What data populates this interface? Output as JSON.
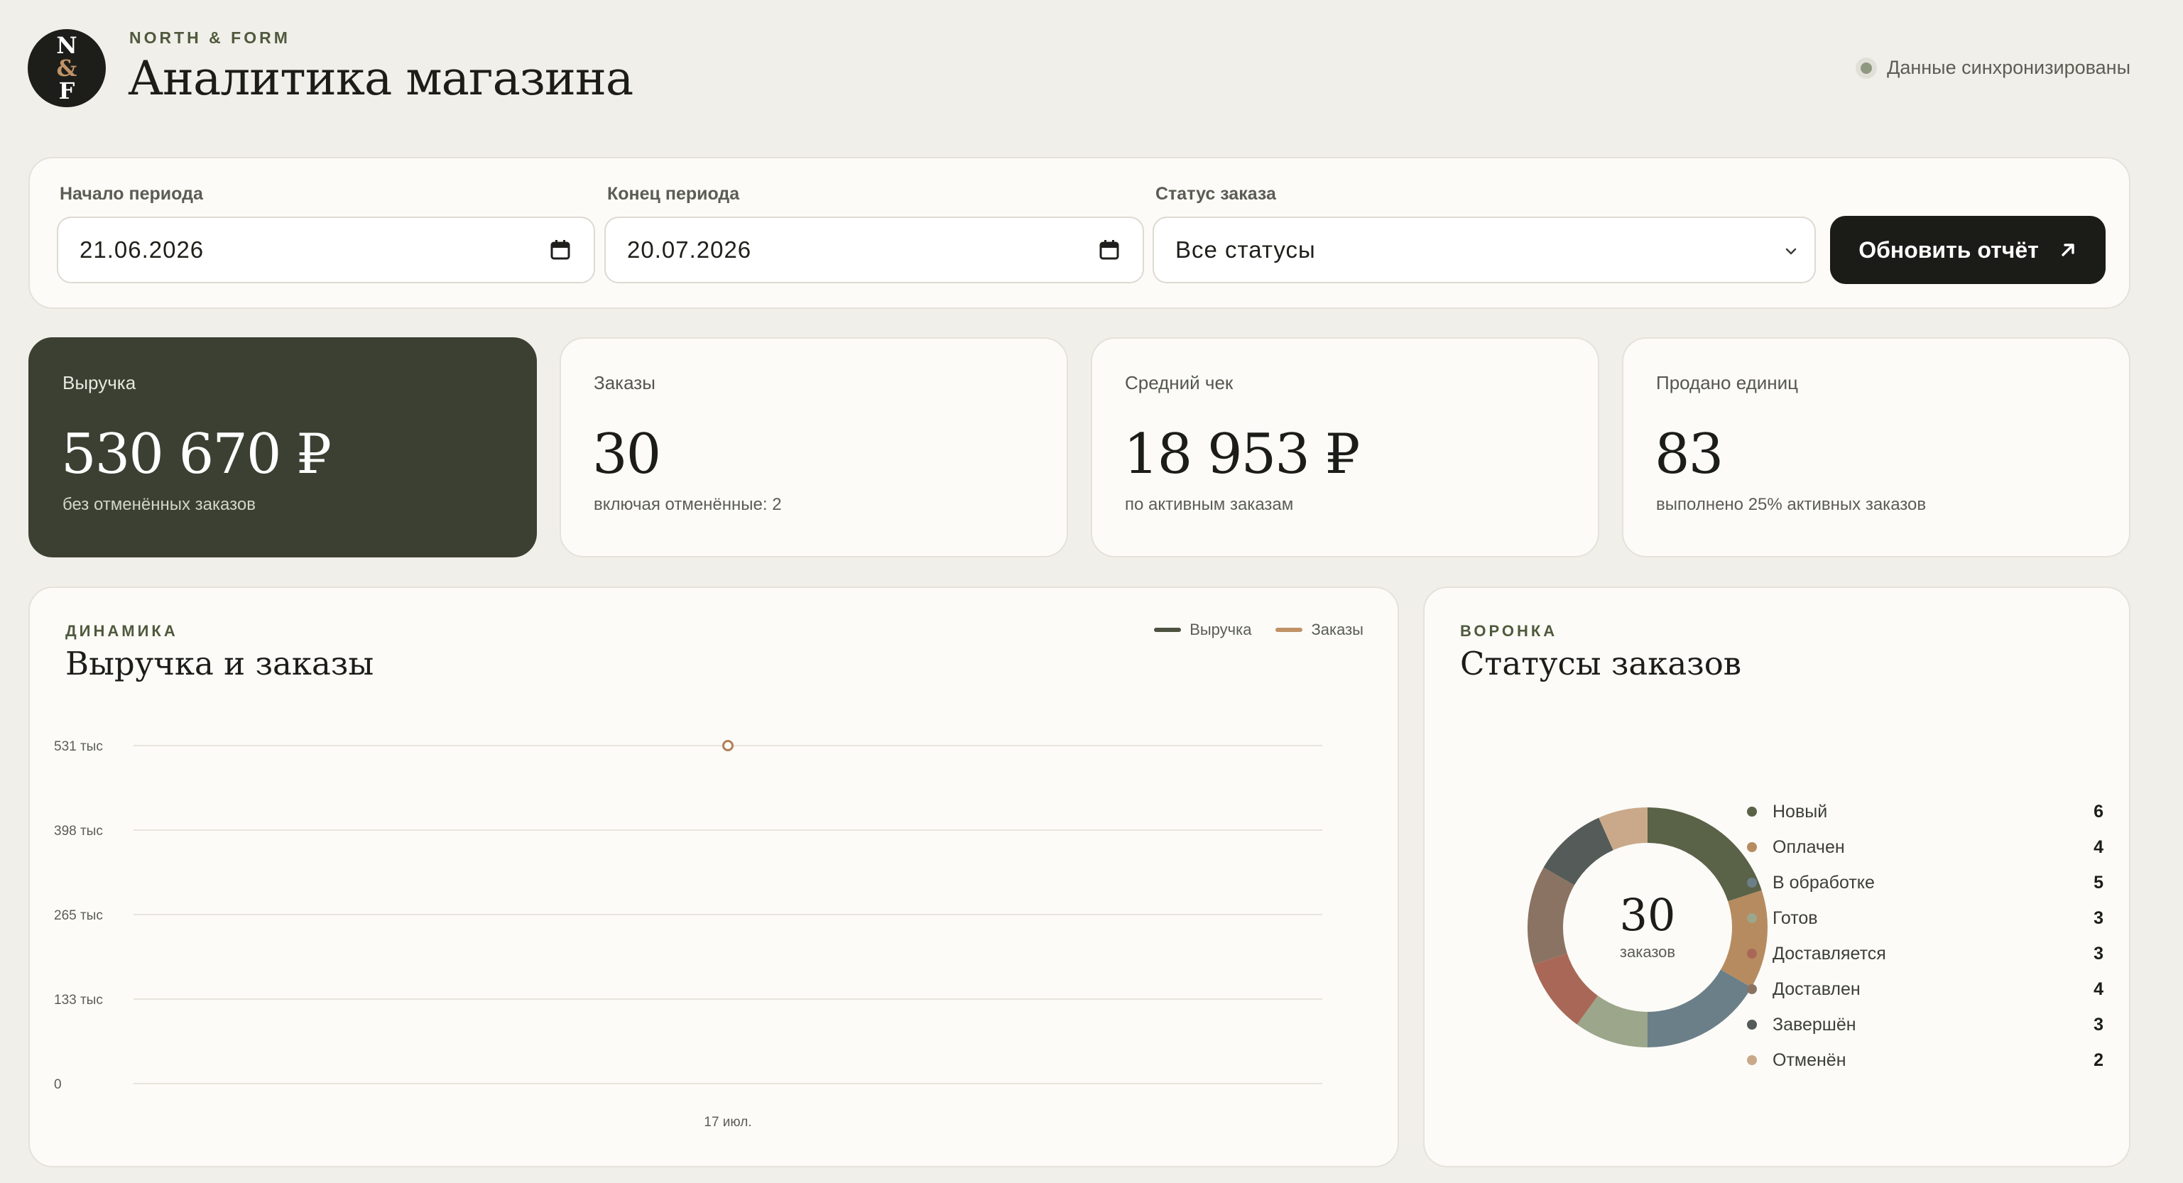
{
  "header": {
    "logo_letters": [
      "N",
      "&",
      "F"
    ],
    "brand": "NORTH & FORM",
    "title": "Аналитика магазина",
    "sync_status": "Данные синхронизированы"
  },
  "filters": {
    "start": {
      "label": "Начало периода",
      "value": "21.06.2026"
    },
    "end": {
      "label": "Конец периода",
      "value": "20.07.2026"
    },
    "status": {
      "label": "Статус заказа",
      "value": "Все статусы"
    },
    "refresh_label": "Обновить отчёт"
  },
  "kpis": [
    {
      "label": "Выручка",
      "value": "530 670 ₽",
      "note": "без отменённых заказов"
    },
    {
      "label": "Заказы",
      "value": "30",
      "note": "включая отменённые: 2"
    },
    {
      "label": "Средний чек",
      "value": "18 953 ₽",
      "note": "по активным заказам"
    },
    {
      "label": "Продано единиц",
      "value": "83",
      "note": "выполнено 25% активных заказов"
    }
  ],
  "dynamics": {
    "eyebrow": "ДИНАМИКА",
    "title": "Выручка и заказы",
    "legend": [
      {
        "name": "Выручка",
        "color": "#4c5240"
      },
      {
        "name": "Заказы",
        "color": "#c09267"
      }
    ]
  },
  "chart_data": {
    "type": "line",
    "x": [
      "17 июл."
    ],
    "series": [
      {
        "name": "Выручка",
        "values": [
          530670
        ]
      },
      {
        "name": "Заказы",
        "values": [
          30
        ]
      }
    ],
    "y_ticks": [
      "531 тыс",
      "398 тыс",
      "265 тыс",
      "133 тыс",
      "0"
    ],
    "ylim": [
      0,
      530670
    ],
    "grid": true,
    "legend_position": "top-right"
  },
  "funnel": {
    "eyebrow": "ВОРОНКА",
    "title": "Статусы заказов",
    "center_value": "30",
    "center_label": "заказов",
    "statuses": [
      {
        "name": "Новый",
        "count": 6,
        "color": "#5a6247"
      },
      {
        "name": "Оплачен",
        "count": 4,
        "color": "#b78b60"
      },
      {
        "name": "В обработке",
        "count": 5,
        "color": "#6b7f88"
      },
      {
        "name": "Готов",
        "count": 3,
        "color": "#9ba68b"
      },
      {
        "name": "Доставляется",
        "count": 3,
        "color": "#a96857"
      },
      {
        "name": "Доставлен",
        "count": 4,
        "color": "#8a7362"
      },
      {
        "name": "Завершён",
        "count": 3,
        "color": "#545b58"
      },
      {
        "name": "Отменён",
        "count": 2,
        "color": "#c9a98a"
      }
    ]
  }
}
